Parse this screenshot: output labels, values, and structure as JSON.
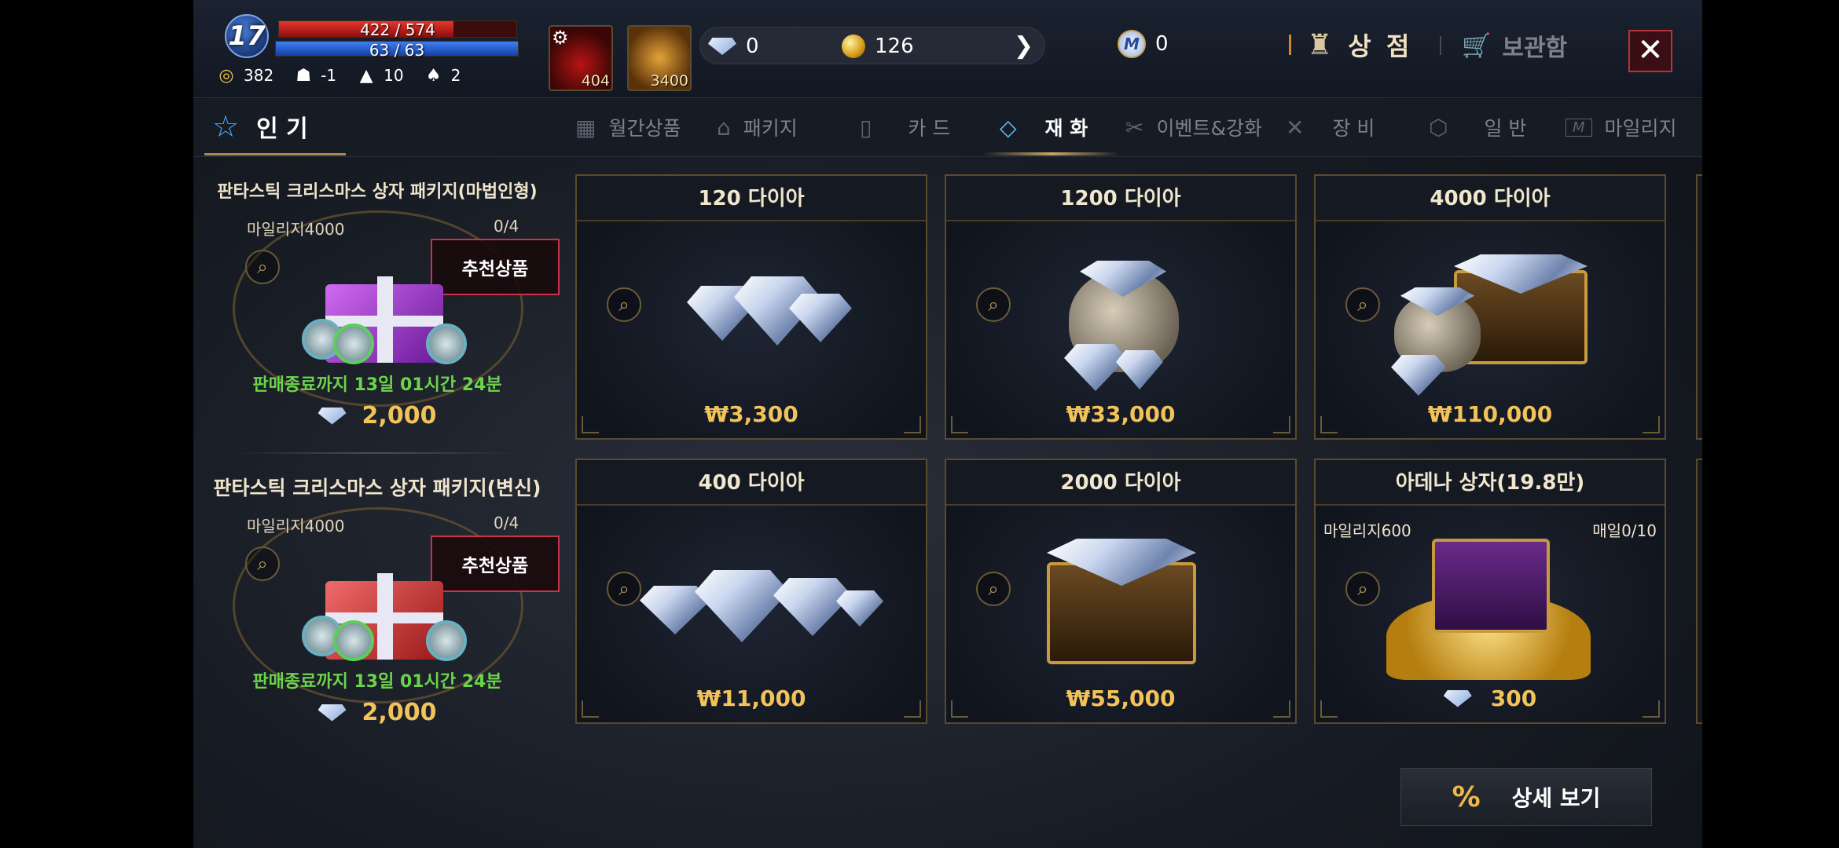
{
  "player": {
    "level": "17",
    "hp": "422 / 574",
    "hp_ratio": 0.735,
    "mp": "63 / 63",
    "mp_ratio": 1.0,
    "stats": [
      {
        "icon": "gold-ring-icon",
        "value": "382"
      },
      {
        "icon": "helmet-icon",
        "value": "-1"
      },
      {
        "icon": "wizard-hat-icon",
        "value": "10"
      },
      {
        "icon": "winged-hat-icon",
        "value": "2"
      }
    ]
  },
  "quick_slots": [
    {
      "name": "potion",
      "count": "404"
    },
    {
      "name": "feather",
      "count": "3400"
    }
  ],
  "currencies": {
    "diamond": "0",
    "gold": "126",
    "mileage": "0",
    "mileage_symbol": "M"
  },
  "header": {
    "shop_label": "상 점",
    "storage_label": "보관함",
    "close_symbol": "✕"
  },
  "tabs": {
    "popular": "인 기",
    "categories": [
      {
        "label": "월간상품",
        "icon": "calendar-icon",
        "symbol": "▦"
      },
      {
        "label": "패키지",
        "icon": "gift-icon",
        "symbol": "⌂"
      },
      {
        "label": "카 드",
        "icon": "card-icon",
        "symbol": "▯"
      },
      {
        "label": "재 화",
        "icon": "diamond-icon",
        "symbol": "◇",
        "active": true
      },
      {
        "label": "이벤트&강화",
        "icon": "tools-icon",
        "symbol": "✂"
      },
      {
        "label": "장 비",
        "icon": "swords-icon",
        "symbol": "✕"
      },
      {
        "label": "일 반",
        "icon": "box-icon",
        "symbol": "⬡"
      },
      {
        "label": "마일리지",
        "icon": "mileage-icon",
        "symbol": "M"
      }
    ]
  },
  "promos": [
    {
      "title": "판타스틱 크리스마스 상자 패키지(마법인형)",
      "mileage": "마일리지4000",
      "limit": "0/4",
      "badge": "추천상품",
      "timer": "판매종료까지 13일 01시간 24분",
      "price": "2,000",
      "box_color": "#a43ad8"
    },
    {
      "title": "판타스틱 크리스마스 상자 패키지(변신)",
      "mileage": "마일리지4000",
      "limit": "0/4",
      "badge": "추천상품",
      "timer": "판매종료까지 13일 01시간 24분",
      "price": "2,000",
      "box_color": "#d8343a"
    }
  ],
  "products": [
    {
      "title": "120 다이아",
      "price": "₩3,300"
    },
    {
      "title": "1200 다이아",
      "price": "₩33,000"
    },
    {
      "title": "4000 다이아",
      "price": "₩110,000"
    },
    {
      "title": "400 다이아",
      "price": "₩11,000"
    },
    {
      "title": "2000 다이아",
      "price": "₩55,000"
    },
    {
      "title": "아데나 상자(19.8만)",
      "price": "300",
      "mileage": "마일리지600",
      "daily": "매일0/10"
    }
  ],
  "footer": {
    "detail_label": "상세 보기",
    "detail_icon": "%"
  },
  "colors": {
    "accent_gold": "#f2c35a",
    "timer_green": "#6cd44a",
    "badge_border": "#c8334a",
    "hp_red": "#e8342c",
    "mp_blue": "#3f7ff0"
  }
}
